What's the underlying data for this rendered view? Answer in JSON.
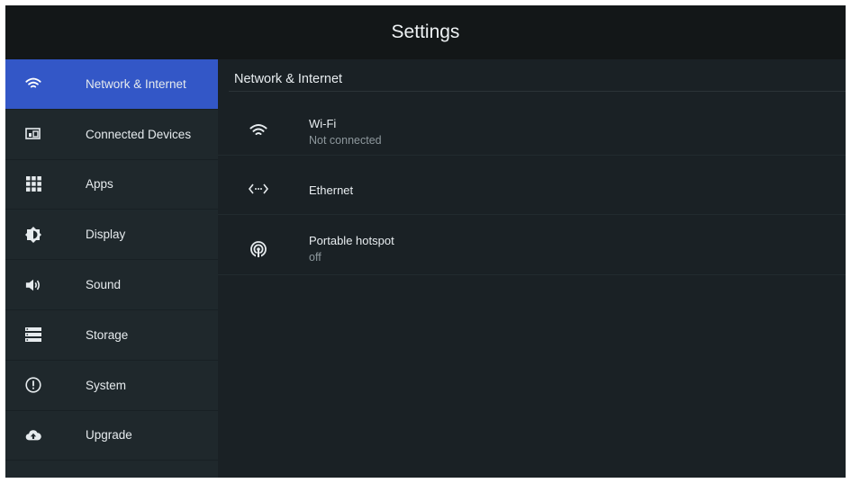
{
  "header": {
    "title": "Settings"
  },
  "sidebar": {
    "items": [
      {
        "label": "Network & Internet",
        "icon": "wifi-icon",
        "active": true
      },
      {
        "label": "Connected Devices",
        "icon": "connected-devices-icon",
        "active": false
      },
      {
        "label": "Apps",
        "icon": "apps-grid-icon",
        "active": false
      },
      {
        "label": "Display",
        "icon": "brightness-icon",
        "active": false
      },
      {
        "label": "Sound",
        "icon": "volume-icon",
        "active": false
      },
      {
        "label": "Storage",
        "icon": "storage-icon",
        "active": false
      },
      {
        "label": "System",
        "icon": "alert-circle-icon",
        "active": false
      },
      {
        "label": "Upgrade",
        "icon": "cloud-upload-icon",
        "active": false
      }
    ]
  },
  "main": {
    "section_title": "Network & Internet",
    "items": [
      {
        "title": "Wi-Fi",
        "subtitle": "Not connected",
        "icon": "wifi-icon"
      },
      {
        "title": "Ethernet",
        "subtitle": "",
        "icon": "ethernet-icon"
      },
      {
        "title": "Portable hotspot",
        "subtitle": "off",
        "icon": "hotspot-icon"
      }
    ]
  },
  "colors": {
    "active_item": "#3357c7",
    "sidebar_bg": "#1f282c",
    "content_bg": "#1a2125",
    "titlebar_bg": "#131718"
  }
}
